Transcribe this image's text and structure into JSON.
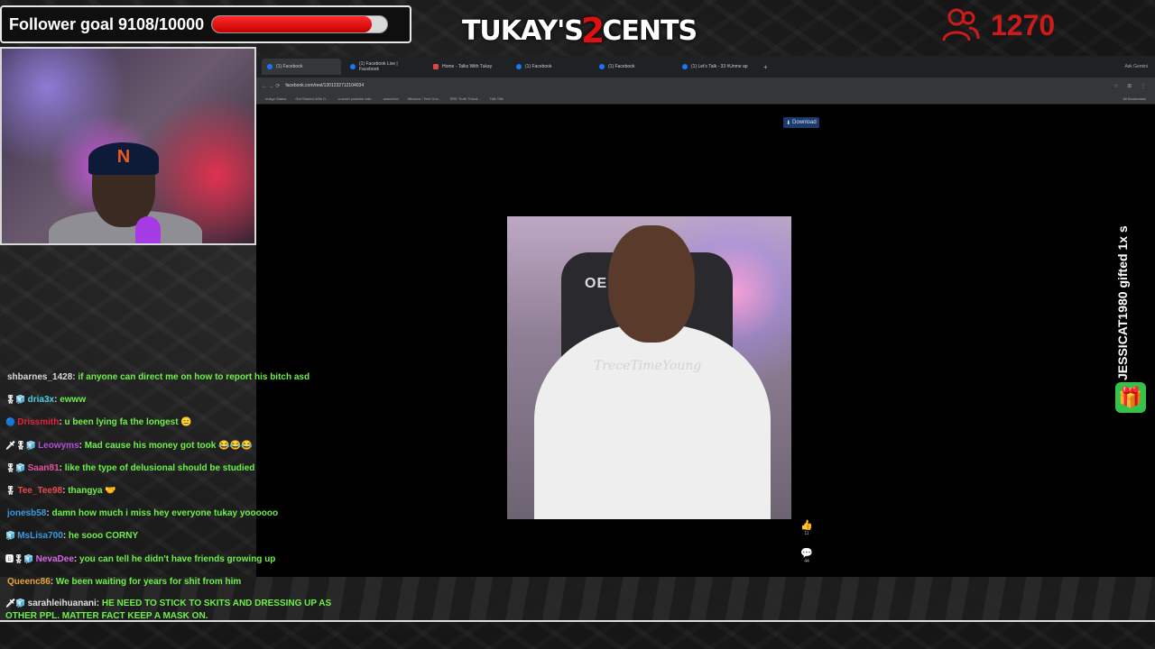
{
  "follower_goal": {
    "label": "Follower goal 9108/10000",
    "progress": 0.9108
  },
  "brand": {
    "part1": "TUKAY'S ",
    "part2": "2",
    "part3": "CENTS"
  },
  "viewers": {
    "count": "1270",
    "icon": "people-icon"
  },
  "webcam": {
    "cap_letter": "N"
  },
  "browser": {
    "tabs": [
      {
        "label": "(1) Facebook",
        "active": true
      },
      {
        "label": "(1) Facebook Live | Facebook"
      },
      {
        "label": "Home - Talks With Tukay"
      },
      {
        "label": "(1) Facebook"
      },
      {
        "label": "(1) Facebook"
      },
      {
        "label": "(1) Let's Talk - 33 #Unme ap"
      }
    ],
    "ask": "Ask Gemini",
    "url": "facebook.com/reel/1301232712104034",
    "bookmarks": [
      "Indigo Status",
      "Get Started With G...",
      "convert youtube vide...",
      "www.blvd",
      "Winston / Terri Gov...",
      "SRE Truth Thrivd...",
      "Talk Tilts"
    ],
    "all_bookmarks": "All Bookmarks",
    "download_label": "Download",
    "watermark": "TreceTimeYoung",
    "chair_text": "OER",
    "likes": "11",
    "comments": "44"
  },
  "chat": [
    {
      "badges": "",
      "name": "shbarnes_1428",
      "name_color": "#d8d8d8",
      "message": "if anyone can direct me on how to report his bitch asd"
    },
    {
      "badges": "🎖🧊",
      "name": "dria3x",
      "name_color": "#4ad1e0",
      "message": "ewww"
    },
    {
      "badges": "🔵",
      "name": "Drissmith",
      "name_color": "#e0223a",
      "message": "u been lying fa the longest 😑"
    },
    {
      "badges": "🗡🎖🧊",
      "name": "Leowyms",
      "name_color": "#b24be0",
      "message": "Mad cause his money got took 😂😂😂"
    },
    {
      "badges": "🎖🧊",
      "name": "Saan81",
      "name_color": "#e0539a",
      "message": "like the type of delusional should be studied"
    },
    {
      "badges": "🎖",
      "name": "Tee_Tee98",
      "name_color": "#e84a4a",
      "message": "thangya 🤝"
    },
    {
      "badges": "",
      "name": "jonesb58",
      "name_color": "#3a9ae0",
      "message": "damn how much i miss hey everyone tukay yoooooo"
    },
    {
      "badges": "🧊",
      "name": "MsLisa700",
      "name_color": "#3a9ae0",
      "message": "he sooo CORNY"
    },
    {
      "badges": "🅱🎖🧊",
      "name": "NevaDee",
      "name_color": "#d867e8",
      "message": "you can tell he didn't have friends growing up"
    },
    {
      "badges": "",
      "name": "Queenc86",
      "name_color": "#e8a23a",
      "message": "We been waiting for years for shit from him"
    },
    {
      "badges": "🗡🧊",
      "name": "sarahleihuanani",
      "name_color": "#e0e0e0",
      "message": "HE NEED TO STICK TO SKITS AND DRESSING UP AS OTHER PPL. MATTER FACT KEEP A MASK ON."
    }
  ],
  "gift_note": "JESSICAT1980 gifted 1x s",
  "colors": {
    "accent_red": "#cc1b1b",
    "chat_message": "#6ef04a",
    "gift_green": "#35c14a"
  }
}
